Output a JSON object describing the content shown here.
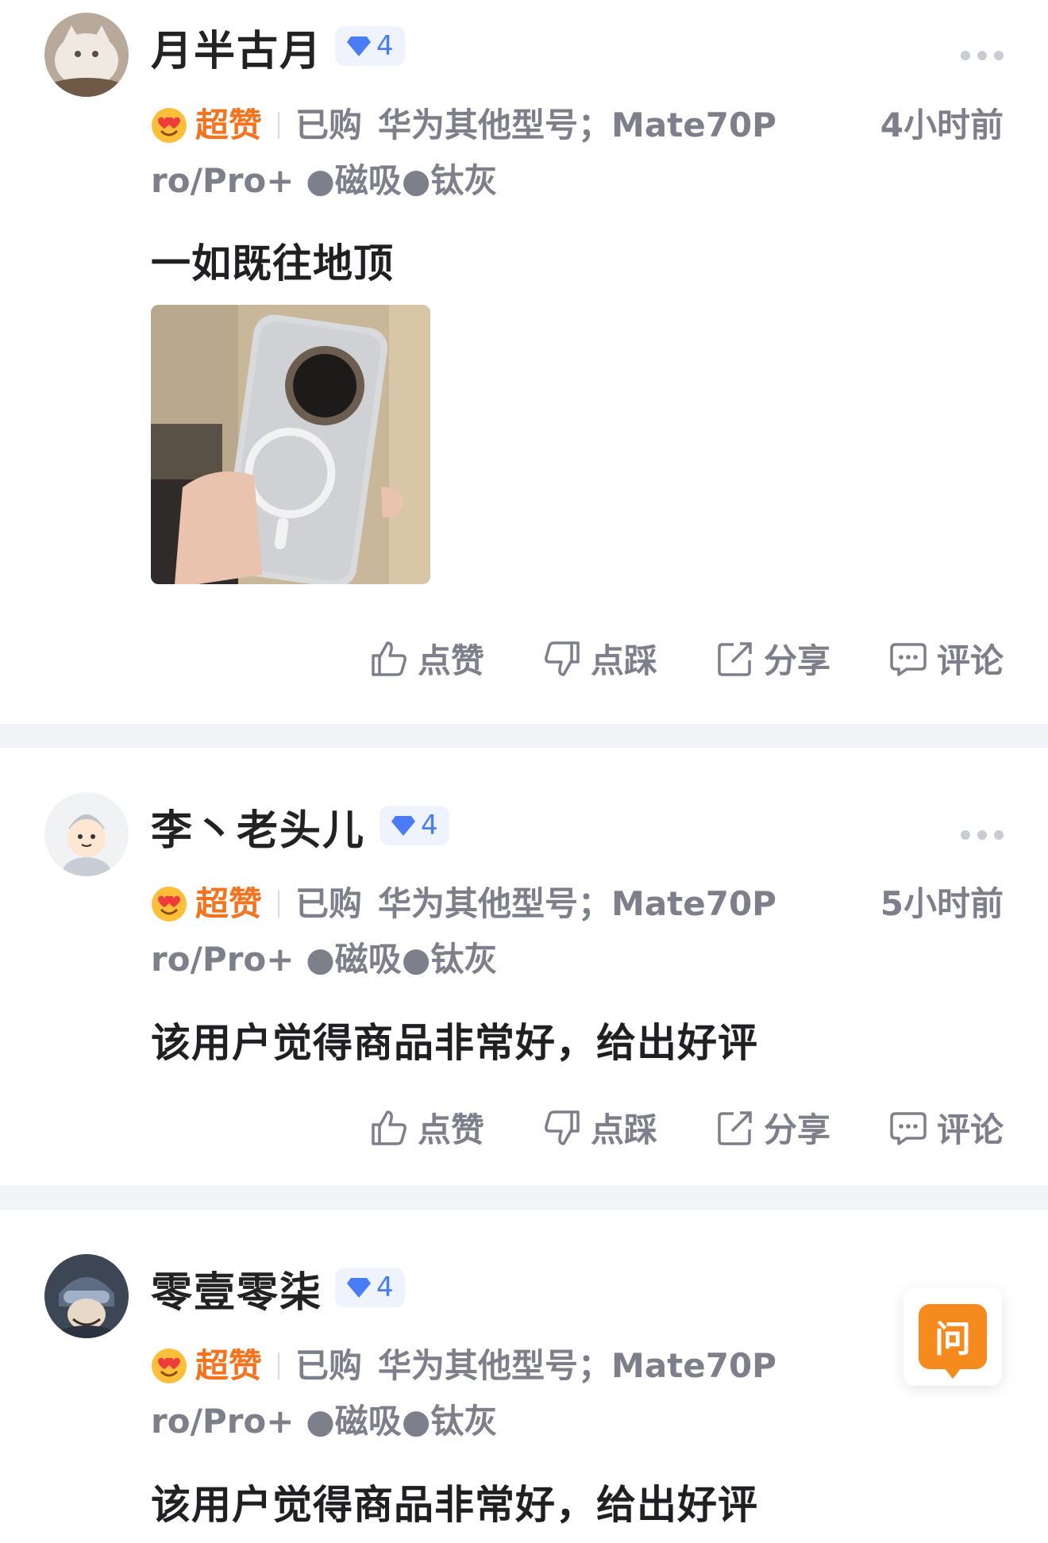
{
  "reviews": [
    {
      "username": "月半古月",
      "level": "4",
      "rating": "超赞",
      "purchase_label": "已购",
      "spec_line1": "华为其他型号；Mate70P",
      "spec_line2": "ro/Pro+ ●磁吸●钛灰",
      "time": "4小时前",
      "content": "一如既往地顶",
      "has_photo": true
    },
    {
      "username": "李丶老头儿",
      "level": "4",
      "rating": "超赞",
      "purchase_label": "已购",
      "spec_line1": "华为其他型号；Mate70P",
      "spec_line2": "ro/Pro+ ●磁吸●钛灰",
      "time": "5小时前",
      "content": "该用户觉得商品非常好，给出好评"
    },
    {
      "username": "零壹零柒",
      "level": "4",
      "rating": "超赞",
      "purchase_label": "已购",
      "spec_line1": "华为其他型号；Mate70P",
      "spec_line2": "ro/Pro+ ●磁吸●钛灰",
      "content": "该用户觉得商品非常好，给出好评"
    }
  ],
  "actions": {
    "like": "点赞",
    "dislike": "点踩",
    "share": "分享",
    "comment": "评论"
  },
  "ask_button": "问",
  "colors": {
    "rating": "#f4731f",
    "level_badge": "#4a7cf6",
    "ask": "#f58a1f"
  }
}
